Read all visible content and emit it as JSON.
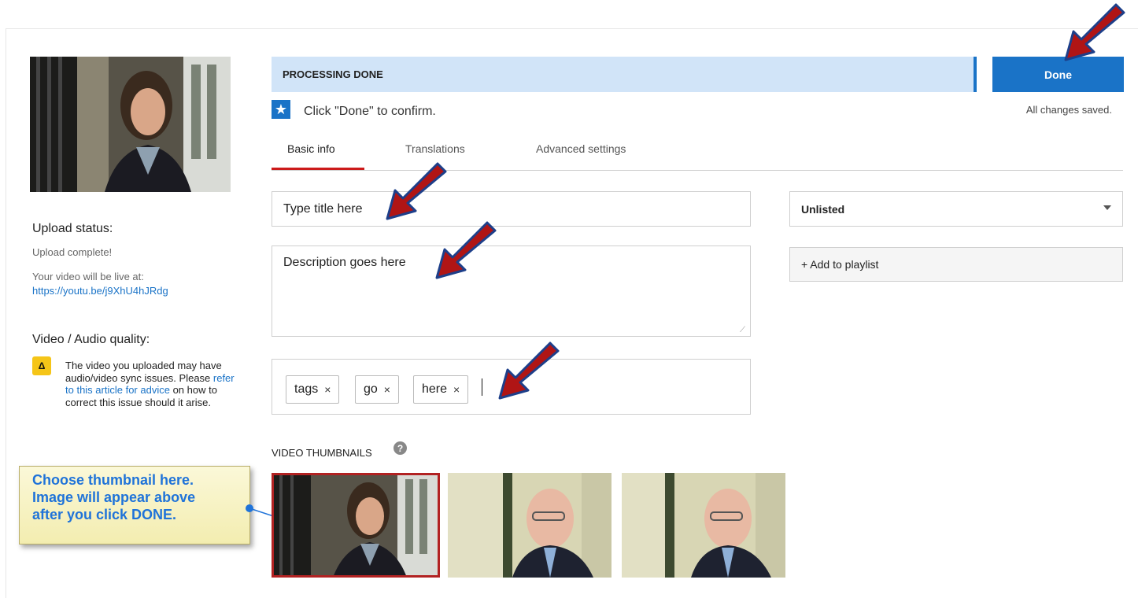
{
  "processing": {
    "status_label": "PROCESSING DONE",
    "done_button": "Done",
    "saved_text": "All changes saved.",
    "confirm_text": "Click \"Done\" to confirm."
  },
  "tabs": [
    {
      "label": "Basic info",
      "active": true
    },
    {
      "label": "Translations",
      "active": false
    },
    {
      "label": "Advanced settings",
      "active": false
    }
  ],
  "form": {
    "title_value": "Type title here",
    "description_value": "Description goes here",
    "tags": [
      "tags",
      "go",
      "here"
    ],
    "tag_remove_glyph": "×",
    "privacy_value": "Unlisted",
    "add_playlist_label": "+ Add to playlist",
    "thumbnails_label": "VIDEO THUMBNAILS",
    "help_glyph": "?"
  },
  "sidebar": {
    "upload_status_heading": "Upload status:",
    "upload_status_text": "Upload complete!",
    "live_at_text": "Your video will be live at:",
    "video_url": "https://youtu.be/j9XhU4hJRdg",
    "quality_heading": "Video / Audio quality:",
    "warning_icon_glyph": "Δ",
    "warning_text_1": "The video you uploaded may have audio/video sync issues. Please ",
    "warning_link": "refer to this article for advice",
    "warning_text_2": " on how to correct this issue should it arise."
  },
  "callout": {
    "line1": "Choose thumbnail here.",
    "line2": "Image will appear above",
    "line3": "after you click DONE."
  },
  "icons": {
    "star": "star-icon",
    "warning": "warning-icon",
    "help": "help-icon",
    "dropdown": "chevron-down-icon"
  },
  "colors": {
    "accent_blue": "#1a73c7",
    "processing_bar": "#d1e4f8",
    "active_tab_underline": "#cc1a1a",
    "guide_arrow": "#b01515",
    "callout_text": "#1f73d9"
  },
  "thumbnails_selected_index": 0
}
